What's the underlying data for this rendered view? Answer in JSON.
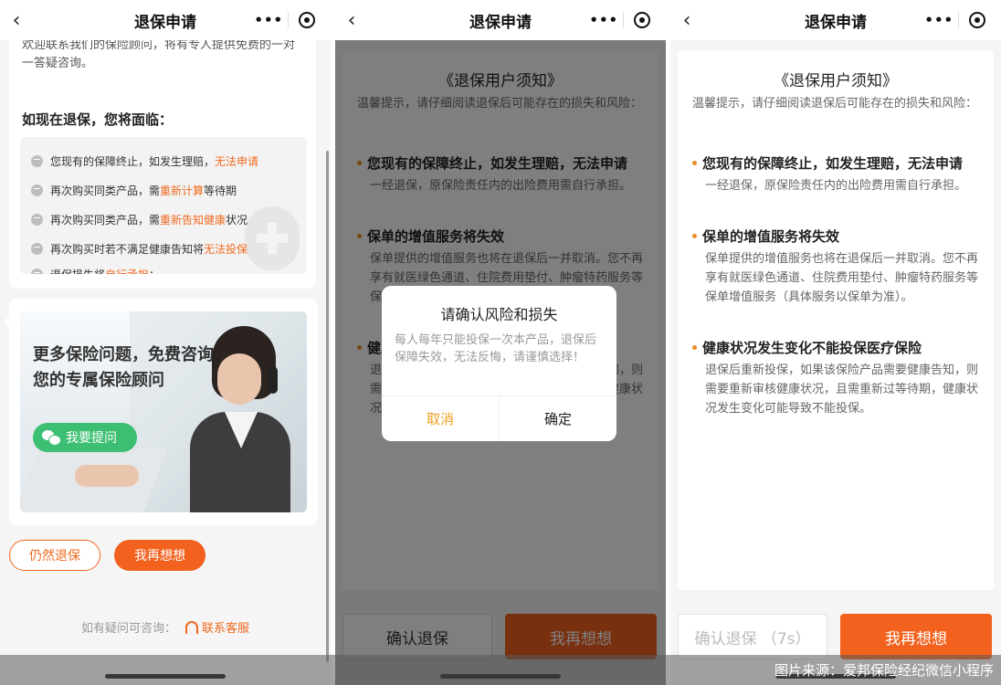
{
  "nav": {
    "title": "退保申请",
    "back": "‹",
    "more": "•••"
  },
  "p1": {
    "intro": "欢迎联系我们的保险顾问，将有专人提供免费的一对一答疑咨询。",
    "face_title": "如现在退保，您将面临：",
    "risks": [
      {
        "pre": "您现有的保障终止，如发生理赔，",
        "hl": "无法申请",
        "post": ""
      },
      {
        "pre": "再次购买同类产品，需",
        "hl": "重新计算",
        "post": "等待期"
      },
      {
        "pre": "再次购买同类产品，需",
        "hl": "重新告知健康",
        "post": "状况"
      },
      {
        "pre": "再次购买时若不满足健康告知将",
        "hl": "无法投保",
        "post": ""
      },
      {
        "pre": "退保损失将",
        "hl": "自行承担",
        "post": "；"
      }
    ],
    "banner_text": "更多保险问题，免费咨询您的专属保险顾问",
    "ask_button": "我要提问",
    "still_surrender": "仍然退保",
    "think_again": "我再想想",
    "contact_prefix": "如有疑问可咨询：",
    "contact_link": "联系客服"
  },
  "notice": {
    "title": "《退保用户须知》",
    "tip": "温馨提示，请仔细阅读退保后可能存在的损失和风险：",
    "sections": [
      {
        "head": "您现有的保障终止，如发生理赔，无法申请",
        "body": "一经退保，原保险责任内的出险费用需自行承担。"
      },
      {
        "head": "保单的增值服务将失效",
        "body": "保单提供的增值服务也将在退保后一并取消。您不再享有就医绿色通道、住院费用垫付、肿瘤特药服务等保单增值服务（具体服务以保单为准）。"
      },
      {
        "head": "健康状况发生变化不能投保医疗保险",
        "body": "退保后重新投保，如果该保险产品需要健康告知，则需要重新审核健康状况，且需重新过等待期，健康状况发生变化可能导致不能投保。"
      }
    ]
  },
  "p2": {
    "confirm_button": "确认退保",
    "think_button": "我再想想",
    "dialog": {
      "title": "请确认风险和损失",
      "body": "每人每年只能投保一次本产品，退保后保障失效，无法反悔，请谨慎选择！",
      "cancel": "取消",
      "ok": "确定"
    }
  },
  "p3": {
    "confirm_button": "确认退保 （7s）",
    "think_button": "我再想想"
  },
  "source": "图片来源：爱邦保险经纪微信小程序"
}
